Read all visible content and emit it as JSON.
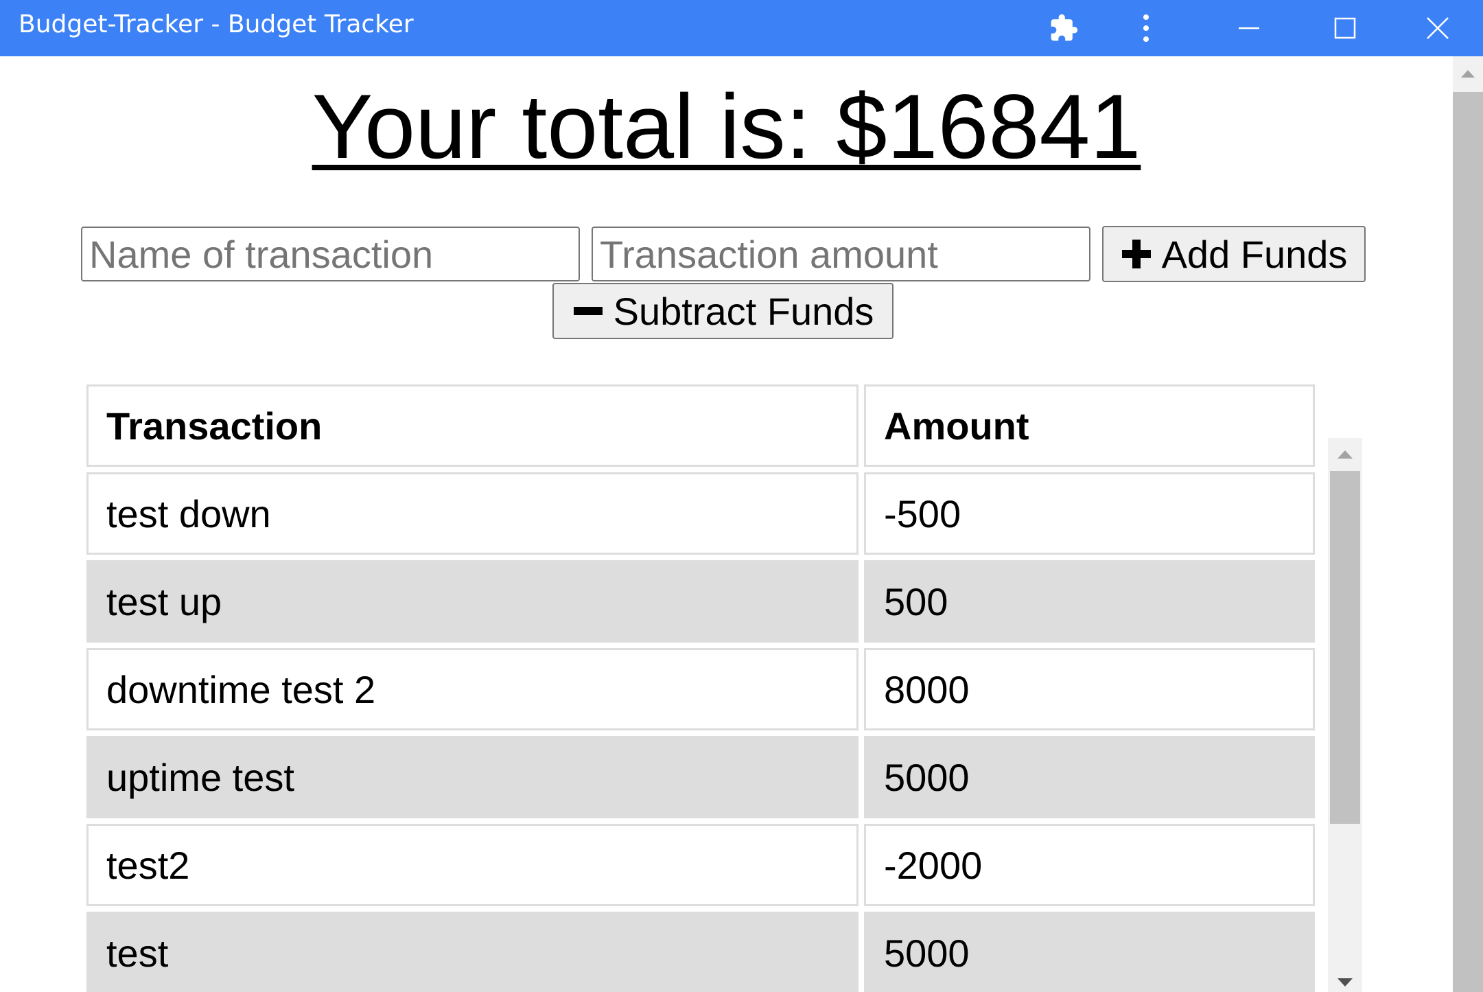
{
  "window": {
    "title": "Budget-Tracker - Budget Tracker",
    "titlebar_color": "#3c82f6",
    "icons": [
      "extension-puzzle-icon",
      "more-vert-icon",
      "minimize-icon",
      "maximize-icon",
      "close-icon"
    ]
  },
  "main": {
    "total_text": "Your total is: $16841",
    "name_input": {
      "placeholder": "Name of transaction",
      "value": ""
    },
    "amount_input": {
      "placeholder": "Transaction amount",
      "value": ""
    },
    "add_button_label": "Add Funds",
    "subtract_button_label": "Subtract Funds"
  },
  "table": {
    "headers": [
      "Transaction",
      "Amount"
    ],
    "rows": [
      {
        "name": "test down",
        "amount": "-500"
      },
      {
        "name": "test up",
        "amount": "500"
      },
      {
        "name": "downtime test 2",
        "amount": "8000"
      },
      {
        "name": "uptime test",
        "amount": "5000"
      },
      {
        "name": "test2",
        "amount": "-2000"
      },
      {
        "name": "test",
        "amount": "5000"
      }
    ],
    "alt_row_color": "#dddddd"
  }
}
